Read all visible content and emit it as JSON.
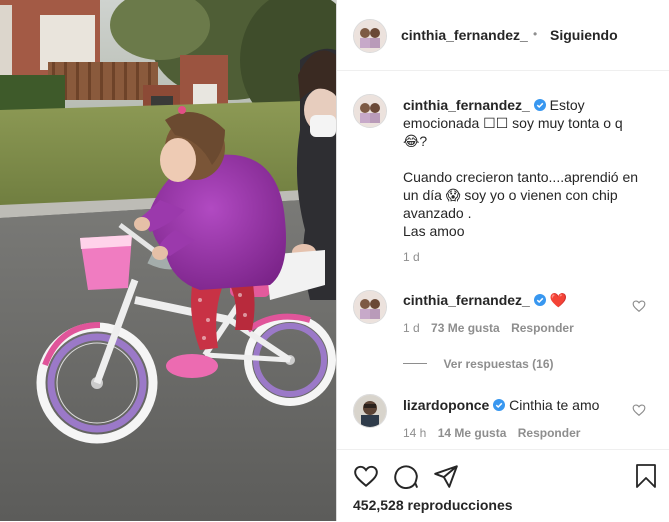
{
  "header": {
    "username": "cinthia_fernandez_",
    "separator": "•",
    "follow_status": "Siguiendo"
  },
  "caption": {
    "username": "cinthia_fernandez_",
    "line1_a": "Estoy",
    "line1_b": "emocionada",
    "boxes": "☐☐",
    "line2_a": "soy muy tonta o q",
    "emoji_laugh": "😂",
    "question": "?",
    "p2_line1": "Cuando crecieron tanto....aprendió en",
    "p2_line2_a": "un día",
    "emoji_scream": "😱",
    "p2_line2_b": "soy yo o vienen con chip",
    "p2_line3": "avanzado .",
    "p2_line4": "Las amoo",
    "time": "1 d"
  },
  "comment1": {
    "username": "cinthia_fernandez_",
    "heart": "❤️",
    "time": "1 d",
    "likes": "73 Me gusta",
    "reply": "Responder",
    "view_replies": "Ver respuestas (16)"
  },
  "comment2": {
    "username": "lizardoponce",
    "text": "Cinthia te amo",
    "time": "14 h",
    "likes": "14 Me gusta",
    "reply": "Responder"
  },
  "footer": {
    "views": "452,528 reproducciones"
  },
  "colors": {
    "verified": "#3897f0",
    "follow": "#262626",
    "heart_red": "#ed4956",
    "muted": "#8e8e8e"
  },
  "icons": [
    "like-icon",
    "comment-icon",
    "share-icon",
    "save-icon",
    "verified-icon",
    "small-heart-icon"
  ]
}
